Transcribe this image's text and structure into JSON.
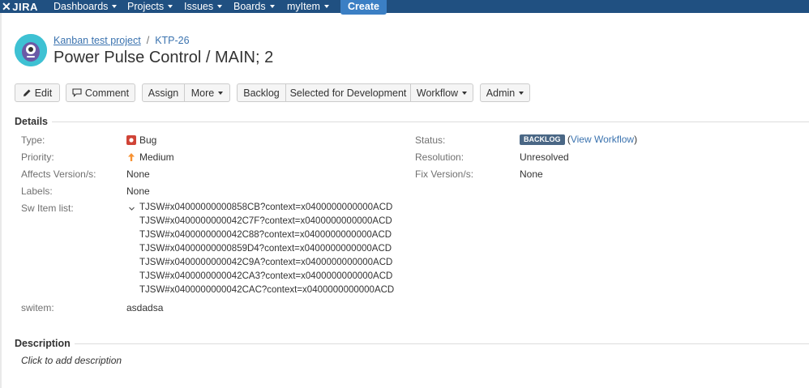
{
  "nav": {
    "logo": "JIRA",
    "items": [
      "Dashboards",
      "Projects",
      "Issues",
      "Boards",
      "myItem"
    ],
    "create": "Create"
  },
  "breadcrumb": {
    "project": "Kanban test project",
    "separator": "/",
    "key": "KTP-26"
  },
  "issue": {
    "title": "Power Pulse Control / MAIN; 2"
  },
  "toolbar": {
    "edit": "Edit",
    "comment": "Comment",
    "assign": "Assign",
    "more": "More",
    "backlog": "Backlog",
    "selected": "Selected for Development",
    "workflow": "Workflow",
    "admin": "Admin"
  },
  "details": {
    "heading": "Details",
    "type_label": "Type:",
    "type_value": "Bug",
    "priority_label": "Priority:",
    "priority_value": "Medium",
    "affects_label": "Affects Version/s:",
    "affects_value": "None",
    "labels_label": "Labels:",
    "labels_value": "None",
    "sw_label": "Sw Item list:",
    "sw_items": [
      "TJSW#x04000000000858CB?context=x0400000000000ACD",
      "TJSW#x0400000000042C7F?context=x0400000000000ACD",
      "TJSW#x0400000000042C88?context=x0400000000000ACD",
      "TJSW#x04000000000859D4?context=x0400000000000ACD",
      "TJSW#x0400000000042C9A?context=x0400000000000ACD",
      "TJSW#x0400000000042CA3?context=x0400000000000ACD",
      "TJSW#x0400000000042CAC?context=x0400000000000ACD"
    ],
    "switem_label": "switem:",
    "switem_value": "asdadsa",
    "status_label": "Status:",
    "status_value": "BACKLOG",
    "view_workflow": "View Workflow",
    "resolution_label": "Resolution:",
    "resolution_value": "Unresolved",
    "fix_label": "Fix Version/s:",
    "fix_value": "None"
  },
  "description": {
    "heading": "Description",
    "placeholder": "Click to add description"
  },
  "colors": {
    "nav": "#205081",
    "create": "#3b7fc4",
    "link": "#3b73af",
    "lozenge": "#4a6785",
    "bug": "#d04437",
    "priority": "#f79232",
    "avatar": "#3ec1d3"
  }
}
